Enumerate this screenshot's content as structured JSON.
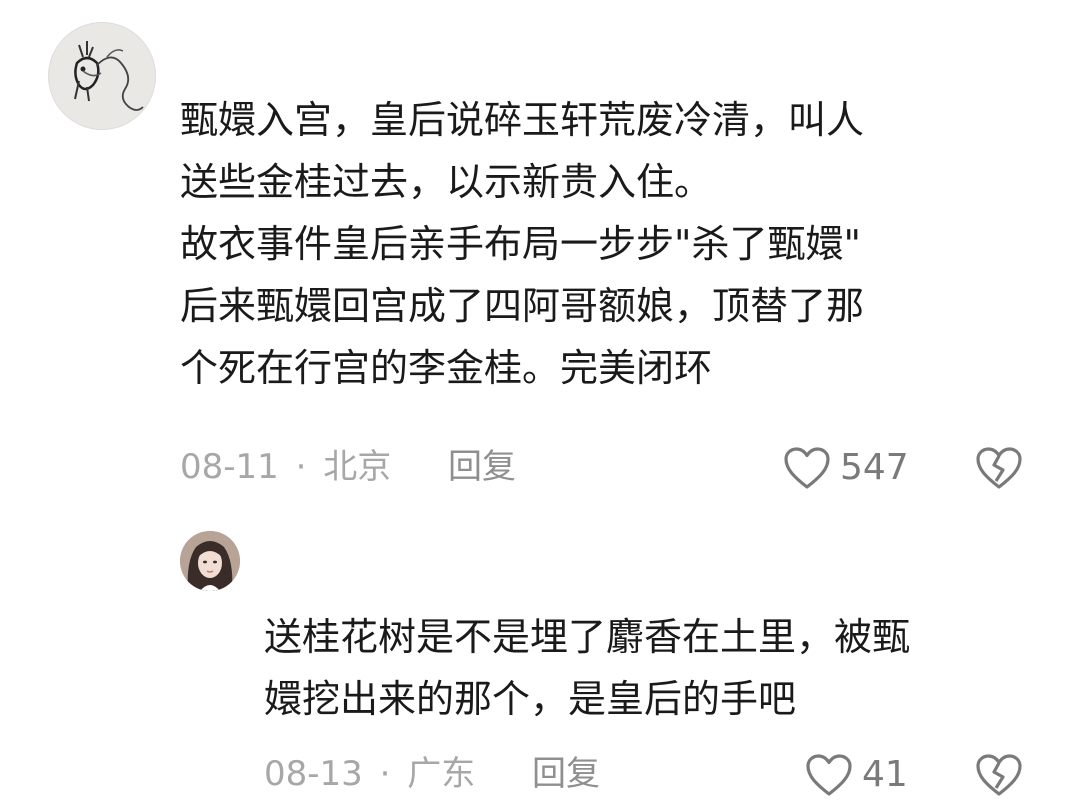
{
  "comments": [
    {
      "avatar": "ink-dragon-sketch-avatar",
      "lines": [
        "甄嬛入宫，皇后说碎玉轩荒废冷清，叫人",
        "送些金桂过去，以示新贵入住。",
        "故衣事件皇后亲手布局一步步\"杀了甄嬛\"",
        "后来甄嬛回宫成了四阿哥额娘，顶替了那",
        "个死在行宫的李金桂。完美闭环"
      ],
      "date": "08-11",
      "separator": "·",
      "location": "北京",
      "reply_label": "回复",
      "likes": "547"
    },
    {
      "avatar": "woman-portrait-avatar",
      "lines": [
        "送桂花树是不是埋了麝香在土里，被甄",
        "嬛挖出来的那个，是皇后的手吧"
      ],
      "date": "08-13",
      "separator": "·",
      "location": "广东",
      "reply_label": "回复",
      "likes": "41"
    }
  ],
  "icons": {
    "like": "heart-outline-icon",
    "dislike": "broken-heart-icon"
  },
  "colors": {
    "text": "#1a1a1a",
    "meta": "#a7a7a7",
    "icon": "#7a7a7a"
  }
}
